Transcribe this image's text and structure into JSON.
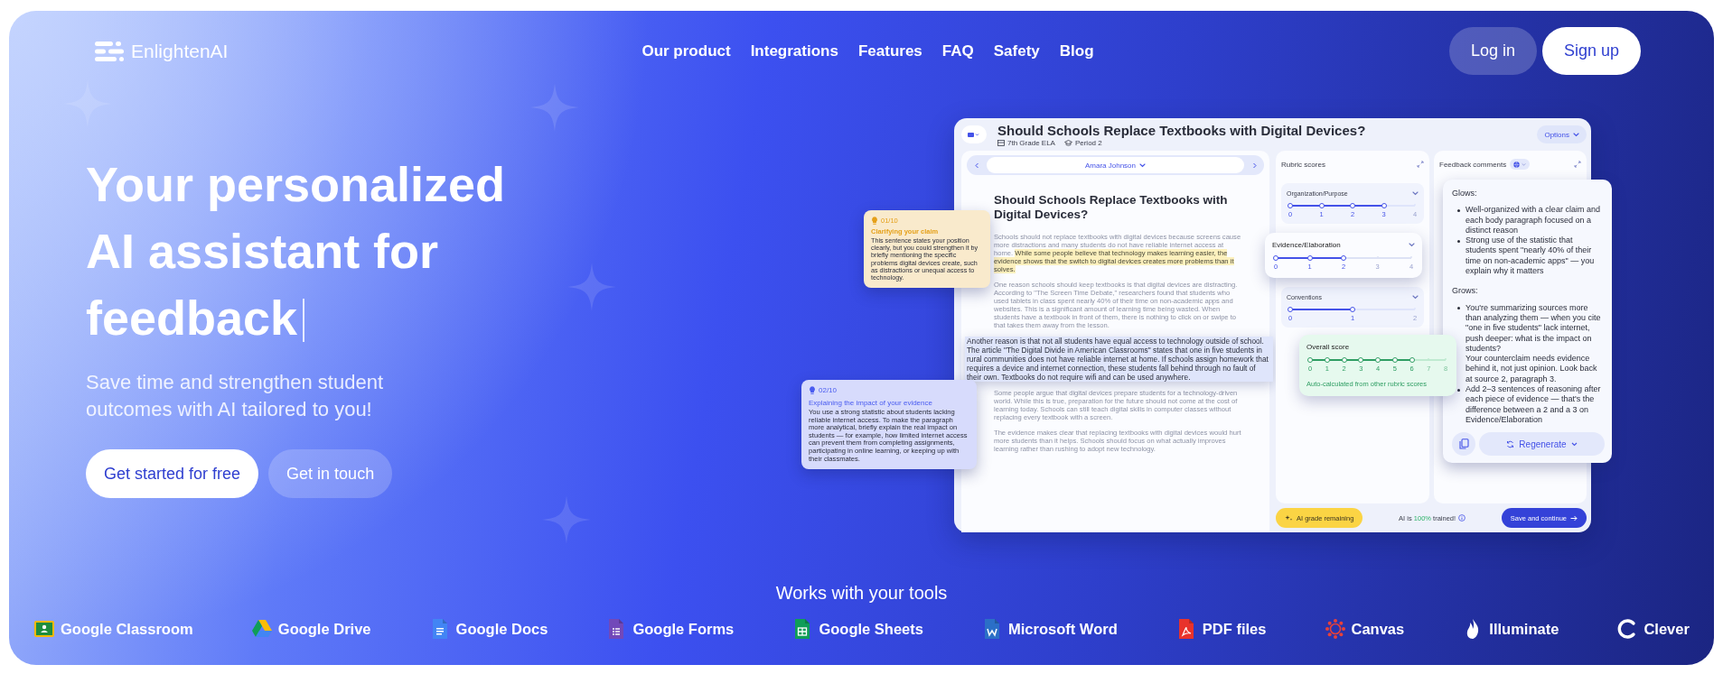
{
  "nav": {
    "logo": "EnlightenAI",
    "links": [
      "Our product",
      "Integrations",
      "Features",
      "FAQ",
      "Safety",
      "Blog"
    ],
    "login": "Log in",
    "signup": "Sign up"
  },
  "hero": {
    "headline": "Your personalized AI assistant for feedback",
    "subtitle": "Save time and strengthen student outcomes with AI tailored to you!",
    "buttons": [
      {
        "label": "Get started for free",
        "kind": "primary"
      },
      {
        "label": "Get in touch",
        "kind": "secondary"
      }
    ]
  },
  "preview": {
    "title": "Should Schools Replace Textbooks with Digital Devices?",
    "class": "7th Grade ELA",
    "period": "Period 2",
    "options": "Options",
    "student": "Amara Johnson",
    "essay": {
      "title": "Should Schools Replace Textbooks with Digital Devices?",
      "paragraphs": [
        {
          "kind": "plain",
          "text": "Schools should not replace textbooks with digital devices because screens cause more distractions and many students do not have reliable internet access at home.",
          "highlight": "While some people believe that technology makes learning easier, the evidence shows that the switch to digital devices creates more problems than it solves."
        },
        {
          "kind": "plain",
          "text": "One reason schools should keep textbooks is that digital devices are distracting. According to \"The Screen Time Debate,\" researchers found that students who used tablets in class spent nearly 40% of their time on non-academic apps and websites. This is a significant amount of learning time being wasted. When students have a textbook in front of them, there is nothing to click on or swipe to that takes them away from the lesson."
        },
        {
          "kind": "focused",
          "text": "Another reason is that not all students have equal access to technology outside of school. The article \"The Digital Divide in American Classrooms\" states that one in five students in rural communities does not have reliable internet at home. If schools assign homework that requires a device and internet connection, these students fall behind through no fault of their own. Textbooks do not require wifi and can be used anywhere."
        },
        {
          "kind": "plain",
          "text": "Some people argue that digital devices prepare students for a technology-driven world. While this is true, preparation for the future should not come at the cost of learning today. Schools can still teach digital skills in computer classes without replacing every textbook with a screen."
        },
        {
          "kind": "plain",
          "text": "The evidence makes clear that replacing textbooks with digital devices would hurt more students than it helps. Schools should focus on what actually improves learning rather than rushing to adopt new technology."
        }
      ]
    },
    "tips": [
      {
        "count": "01/10",
        "title": "Clarifying your claim",
        "body": "This sentence states your position clearly, but you could strengthen it by briefly mentioning the specific problems digital devices create, such as distractions or unequal access to technology.",
        "color": "#e5a019"
      },
      {
        "count": "02/10",
        "title": "Explaining the impact of your evidence",
        "body": "You use a strong statistic about students lacking reliable internet access. To make the paragraph more analytical, briefly explain the real impact on students — for example, how limited internet access can prevent them from completing assignments, participating in online learning, or keeping up with their classmates.",
        "color": "#4a5cf0"
      }
    ],
    "rubric": {
      "title": "Rubric scores",
      "criteria": [
        {
          "name": "Organization/Purpose",
          "labels": [
            "0",
            "1",
            "2",
            "3",
            "4"
          ],
          "level": 0.75,
          "selected": false
        },
        {
          "name": "Evidence/Elaboration",
          "labels": [
            "0",
            "1",
            "2",
            "3",
            "4"
          ],
          "level": 0.5,
          "selected": true
        },
        {
          "name": "Conventions",
          "labels": [
            "0",
            "1",
            "2"
          ],
          "level": 0.5,
          "selected": false
        }
      ],
      "overall": {
        "title": "Overall score",
        "labels": [
          "0",
          "1",
          "2",
          "3",
          "4",
          "5",
          "6",
          "7",
          "8"
        ],
        "level": 0.75,
        "note": "Auto-calculated from other rubric scores"
      }
    },
    "feedback": {
      "title": "Feedback comments",
      "sections": [
        {
          "heading": "Glows:",
          "items": [
            {
              "kind": "bullet",
              "text": "Well-organized with a clear claim and each body paragraph focused on a distinct reason"
            },
            {
              "kind": "bullet",
              "text": "Strong use of the statistic that students spent \"nearly 40% of their time on non-academic apps\" — you explain why it matters"
            }
          ]
        },
        {
          "heading": "Grows:",
          "items": [
            {
              "kind": "bullet",
              "text": "You're summarizing sources more than analyzing them — when you cite \"one in five students\" lack internet, push deeper: what is the impact on students?"
            },
            {
              "kind": "continuation",
              "text": "Your counterclaim needs evidence behind it, not just opinion. Look back at source 2, paragraph 3."
            },
            {
              "kind": "bullet",
              "text": "Add 2–3 sentences of reasoning after each piece of evidence — that's the difference between a 2 and a 3 on Evidence/Elaboration"
            }
          ]
        }
      ],
      "regenerate": "Regenerate"
    },
    "footer": {
      "grade": "AI grade remaining",
      "trained_prefix": "AI is",
      "trained_value": "100%",
      "trained_suffix": "trained!",
      "save": "Save and continue"
    }
  },
  "tools": {
    "title": "Works with your tools",
    "items": [
      {
        "name": "Google Classroom",
        "kind": "classroom"
      },
      {
        "name": "Google Drive",
        "kind": "drive"
      },
      {
        "name": "Google Docs",
        "kind": "docs"
      },
      {
        "name": "Google Forms",
        "kind": "forms"
      },
      {
        "name": "Google Sheets",
        "kind": "sheets"
      },
      {
        "name": "Microsoft Word",
        "kind": "word"
      },
      {
        "name": "PDF files",
        "kind": "pdf"
      },
      {
        "name": "Canvas",
        "kind": "canvas"
      },
      {
        "name": "Illuminate",
        "kind": "illuminate"
      },
      {
        "name": "Clever",
        "kind": "clever"
      }
    ]
  }
}
